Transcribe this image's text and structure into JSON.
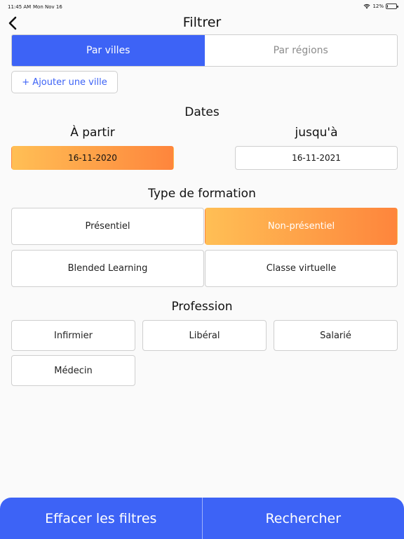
{
  "status_bar": {
    "time": "11:45 AM",
    "date": "Mon Nov 16",
    "battery": "12%",
    "battery_level": 0.12
  },
  "header": {
    "title": "Filtrer",
    "back_icon": "chevron-left-icon"
  },
  "segment": {
    "options": [
      {
        "label": "Par villes",
        "active": true
      },
      {
        "label": "Par régions",
        "active": false
      }
    ]
  },
  "add_city": {
    "label": "+ Ajouter une ville"
  },
  "dates": {
    "section_title": "Dates",
    "from_label": "À partir",
    "to_label": "jusqu'à",
    "from_value": "16-11-2020",
    "to_value": "16-11-2021"
  },
  "training_type": {
    "section_title": "Type de formation",
    "options": [
      {
        "label": "Présentiel",
        "selected": false
      },
      {
        "label": "Non-présentiel",
        "selected": true
      },
      {
        "label": "Blended Learning",
        "selected": false
      },
      {
        "label": "Classe virtuelle",
        "selected": false
      }
    ]
  },
  "profession": {
    "section_title": "Profession",
    "options": [
      {
        "label": "Infirmier"
      },
      {
        "label": "Libéral"
      },
      {
        "label": "Salarié"
      },
      {
        "label": "Médecin"
      }
    ]
  },
  "footer": {
    "clear_label": "Effacer les filtres",
    "search_label": "Rechercher"
  },
  "colors": {
    "accent": "#3d63f6",
    "selected_gradient_start": "#ffbf55",
    "selected_gradient_end": "#fe853c"
  }
}
